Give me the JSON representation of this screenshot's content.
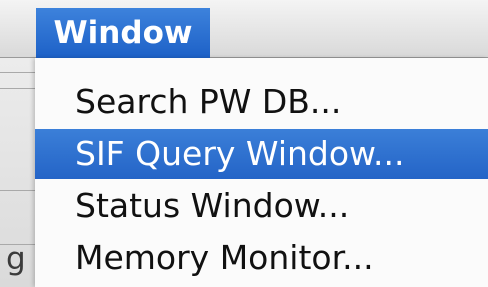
{
  "menu_bar": {
    "active_menu": "Window"
  },
  "dropdown": {
    "items": [
      {
        "label": "Search PW DB...",
        "selected": false
      },
      {
        "label": "SIF Query Window...",
        "selected": true
      },
      {
        "label": "Status Window...",
        "selected": false
      },
      {
        "label": "Memory Monitor...",
        "selected": false
      }
    ]
  },
  "background": {
    "partial_text": "g"
  },
  "colors": {
    "selection_blue": "#2f6fd0",
    "menu_background": "#fbfbfb",
    "menubar_background": "#e6e6e6"
  }
}
